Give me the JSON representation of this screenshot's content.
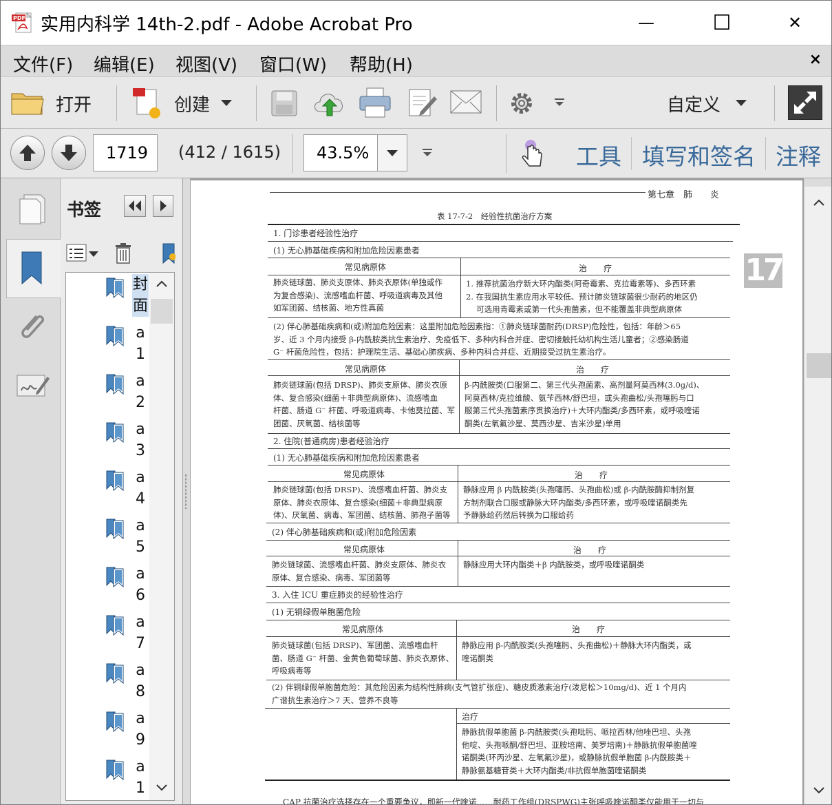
{
  "window": {
    "title": "实用内科学 14th-2.pdf - Adobe Acrobat Pro",
    "minimize": "—",
    "maximize": "☐",
    "close": "✕"
  },
  "menubar": {
    "items": [
      "文件(F)",
      "编辑(E)",
      "视图(V)",
      "窗口(W)",
      "帮助(H)"
    ],
    "close": "×"
  },
  "toolbar": {
    "open_label": "打开",
    "create_label": "创建",
    "customize_label": "自定义"
  },
  "navbar": {
    "page_number": "1719",
    "page_info": "(412 / 1615)",
    "zoom": "43.5%",
    "tools_link": "工具",
    "fill_sign_link": "填写和签名",
    "comment_link": "注释"
  },
  "bookmarks": {
    "title": "书签",
    "items": [
      {
        "l1": "封",
        "l2": "面"
      },
      {
        "l1": "a",
        "l2": "1"
      },
      {
        "l1": "a",
        "l2": "2"
      },
      {
        "l1": "a",
        "l2": "3"
      },
      {
        "l1": "a",
        "l2": "4"
      },
      {
        "l1": "a",
        "l2": "5"
      },
      {
        "l1": "a",
        "l2": "6"
      },
      {
        "l1": "a",
        "l2": "7"
      },
      {
        "l1": "a",
        "l2": "8"
      },
      {
        "l1": "a",
        "l2": "9"
      },
      {
        "l1": "a",
        "l2": "1"
      }
    ]
  },
  "document": {
    "running_header": "第七章　肺　　炎",
    "table_title": "表 17-7-2　经验性抗菌治疗方案",
    "chapter_badge": "17",
    "s1": "1. 门诊患者经验性治疗",
    "s1a": "(1) 无心肺基础疾病和附加危险因素患者",
    "col_pathogen": "常见病原体",
    "col_treatment": "治　　疗",
    "r1_path": [
      "肺炎链球菌、肺炎支原体、肺炎衣原体(单独或作",
      "为复合感染)、流感嗜血杆菌、呼吸道病毒及其他",
      "如军团菌、结核菌、地方性真菌"
    ],
    "r1_treat": [
      "1. 推荐抗菌治疗新大环内酯类(阿奇霉素、克拉霉素等)、多西环素",
      "2. 在我国抗生素应用水平较低、预计肺炎链球菌很少耐药的地区仍",
      "　 可选用青霉素或第一代头孢菌素，但不能覆盖非典型病原体"
    ],
    "s1b": [
      "(2) 伴心肺基础疾病和(或)附加危险因素：这里附加危险因素指：①肺炎链球菌耐药(DRSP)危险性，包括：年龄＞65",
      "岁、近 3 个月内接受 β-内酰胺类抗生素治疗、免疫低下、多种内科合并症、密切接触托幼机构生活儿童者；②感染肠道",
      "G⁻ 杆菌危险性，包括：护理院生活、基础心肺疾病、多种内科合并症、近期接受过抗生素治疗。"
    ],
    "r2_path": [
      "肺炎链球菌(包括 DRSP)、肺炎支原体、肺炎衣原",
      "体、复合感染(细菌＋非典型病原体)、流感嗜血",
      "杆菌、肠道 G⁻ 杆菌、呼吸道病毒、卡他莫拉菌、军",
      "团菌、厌氧菌、结核菌等"
    ],
    "r2_treat": [
      "β-内酰胺类(口服第二、第三代头孢菌素、高剂量阿莫西林(3.0g/d)、",
      "阿莫西林/克拉维酸、氨苄西林/舒巴坦，或头孢曲松/头孢噻肟与口",
      "服第三代头孢菌素序贯换治疗)＋大环内酯类/多西环素，或呼吸喹诺",
      "酮类(左氧氟沙星、莫西沙星、吉米沙星)单用"
    ],
    "s2": "2. 住院(普通病房)患者经验治疗",
    "s2a": "(1) 无心肺基础疾病和附加危险因素患者",
    "r3_path": [
      "肺炎链球菌(包括 DRSP)、流感嗜血杆菌、肺炎支",
      "原体、肺炎衣原体、复合感染(细菌＋非典型病原",
      "体)、厌氧菌、病毒、军团菌、结核菌、肺孢子菌等"
    ],
    "r3_treat": [
      "静脉应用 β 内酰胺类(头孢噻肟、头孢曲松)或 β-内酰胺酶抑制剂复",
      "方制剂联合口服或静脉大环内酯类/多西环素，或呼吸喹诺酮类先",
      "予静脉给药然后转换为口服给药"
    ],
    "s2b": "(2) 伴心肺基础疾病和(或)附加危险因素",
    "r4_path": [
      "肺炎链球菌、流感嗜血杆菌、肺炎支原体、肺炎衣",
      "原体、复合感染、病毒、军团菌等"
    ],
    "r4_treat": [
      "静脉应用大环内酯类＋β 内酰胺类，或呼吸喹诺酮类"
    ],
    "s3": "3. 入住 ICU 重症肺炎的经验性治疗",
    "s3a": "(1) 无铜绿假单胞菌危险",
    "r5_path": [
      "肺炎链球菌(包括 DRSP)、军团菌、流感嗜血杆",
      "菌、肠道 G⁻ 杆菌、金黄色葡萄球菌、肺炎衣原体、",
      "呼吸病毒等"
    ],
    "r5_treat": [
      "静脉应用 β-内酰胺类(头孢噻肟、头孢曲松)＋静脉大环内酯类，或",
      "喹诺酮类"
    ],
    "s3b": [
      "(2) 伴铜绿假单胞菌危险：其危险因素为结构性肺病(支气管扩张症)、糖皮质激素治疗(泼尼松＞10mg/d)、近 1 个月内",
      "广谱抗生素治疗＞7 天、营养不良等"
    ],
    "col_treatment2": "治疗",
    "r6_treat": [
      "静脉抗假单胞菌 β-内酰胺类(头孢吡肟、哌拉西林/他唑巴坦、头孢",
      "他啶、头孢哌酮/舒巴坦、亚胺培南、美罗培南)＋静脉抗假单胞菌喹",
      "诺酮类(环丙沙星、左氧氟沙星)，或静脉抗假单胞菌 β-内酰胺类＋",
      "静脉氨基糖苷类＋大环内酯类/非抗假单胞菌喹诺酮类"
    ],
    "footer_text": "CAP 抗菌治疗选择存在一个重要争议，即新一代喹诺……耐药工作组(DRSPWG)主张呼吸喹诺酮类仅能用于一切与"
  }
}
